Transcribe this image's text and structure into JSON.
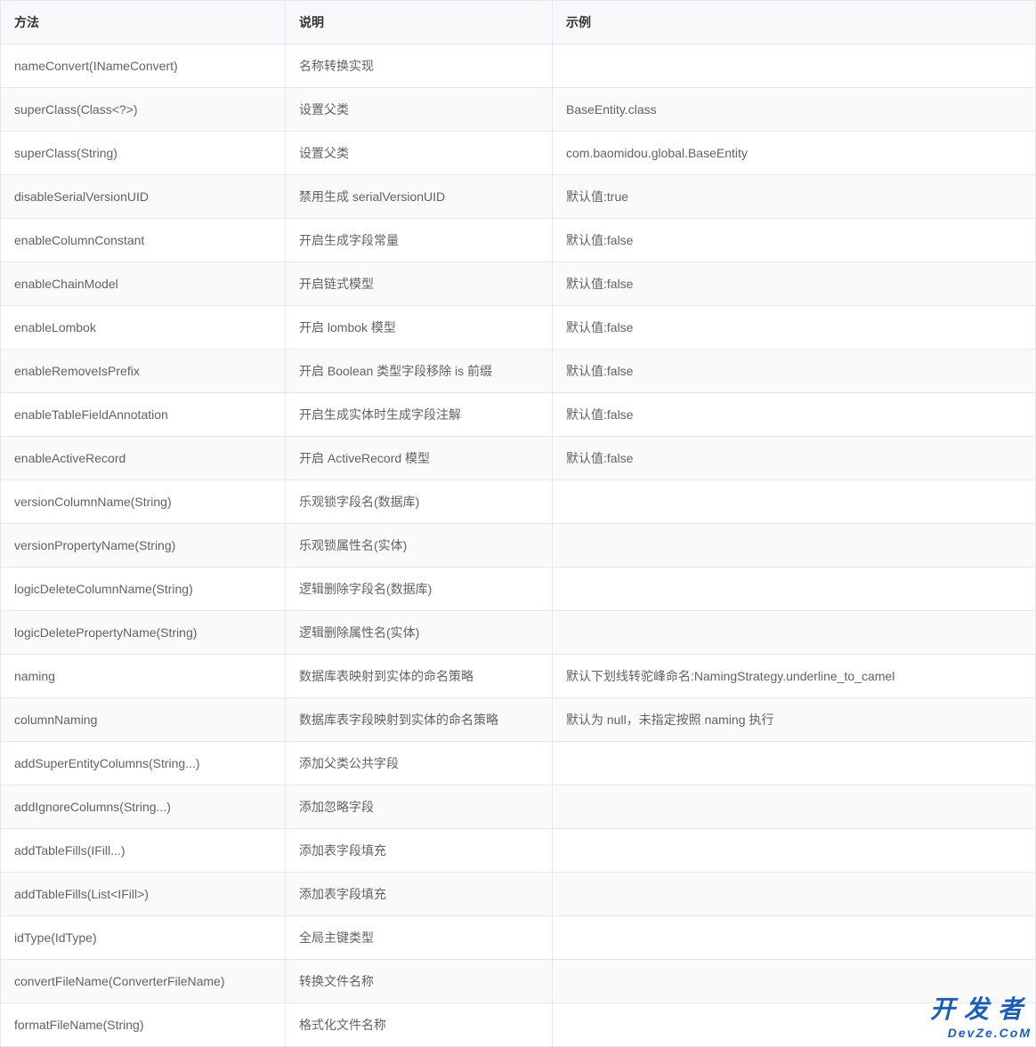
{
  "table": {
    "headers": {
      "method": "方法",
      "description": "说明",
      "example": "示例"
    },
    "rows": [
      {
        "method": "nameConvert(INameConvert)",
        "description": "名称转换实现",
        "example": ""
      },
      {
        "method": "superClass(Class<?>)",
        "description": "设置父类",
        "example": "BaseEntity.class"
      },
      {
        "method": "superClass(String)",
        "description": "设置父类",
        "example": "com.baomidou.global.BaseEntity"
      },
      {
        "method": "disableSerialVersionUID",
        "description": "禁用生成 serialVersionUID",
        "example": "默认值:true"
      },
      {
        "method": "enableColumnConstant",
        "description": "开启生成字段常量",
        "example": "默认值:false"
      },
      {
        "method": "enableChainModel",
        "description": "开启链式模型",
        "example": "默认值:false"
      },
      {
        "method": "enableLombok",
        "description": "开启 lombok 模型",
        "example": "默认值:false"
      },
      {
        "method": "enableRemoveIsPrefix",
        "description": "开启 Boolean 类型字段移除 is 前缀",
        "example": "默认值:false"
      },
      {
        "method": "enableTableFieldAnnotation",
        "description": "开启生成实体时生成字段注解",
        "example": "默认值:false"
      },
      {
        "method": "enableActiveRecord",
        "description": "开启 ActiveRecord 模型",
        "example": "默认值:false"
      },
      {
        "method": "versionColumnName(String)",
        "description": "乐观锁字段名(数据库)",
        "example": ""
      },
      {
        "method": "versionPropertyName(String)",
        "description": "乐观锁属性名(实体)",
        "example": ""
      },
      {
        "method": "logicDeleteColumnName(String)",
        "description": "逻辑删除字段名(数据库)",
        "example": ""
      },
      {
        "method": "logicDeletePropertyName(String)",
        "description": "逻辑删除属性名(实体)",
        "example": ""
      },
      {
        "method": "naming",
        "description": "数据库表映射到实体的命名策略",
        "example": "默认下划线转驼峰命名:NamingStrategy.underline_to_camel"
      },
      {
        "method": "columnNaming",
        "description": "数据库表字段映射到实体的命名策略",
        "example": "默认为 null，未指定按照 naming 执行"
      },
      {
        "method": "addSuperEntityColumns(String...)",
        "description": "添加父类公共字段",
        "example": ""
      },
      {
        "method": "addIgnoreColumns(String...)",
        "description": "添加忽略字段",
        "example": ""
      },
      {
        "method": "addTableFills(IFill...)",
        "description": "添加表字段填充",
        "example": ""
      },
      {
        "method": "addTableFills(List<IFill>)",
        "description": "添加表字段填充",
        "example": ""
      },
      {
        "method": "idType(IdType)",
        "description": "全局主键类型",
        "example": ""
      },
      {
        "method": "convertFileName(ConverterFileName)",
        "description": "转换文件名称",
        "example": ""
      },
      {
        "method": "formatFileName(String)",
        "description": "格式化文件名称",
        "example": ""
      }
    ]
  },
  "watermark": {
    "line1": "开发者",
    "line2": "DevZe.CoM"
  }
}
